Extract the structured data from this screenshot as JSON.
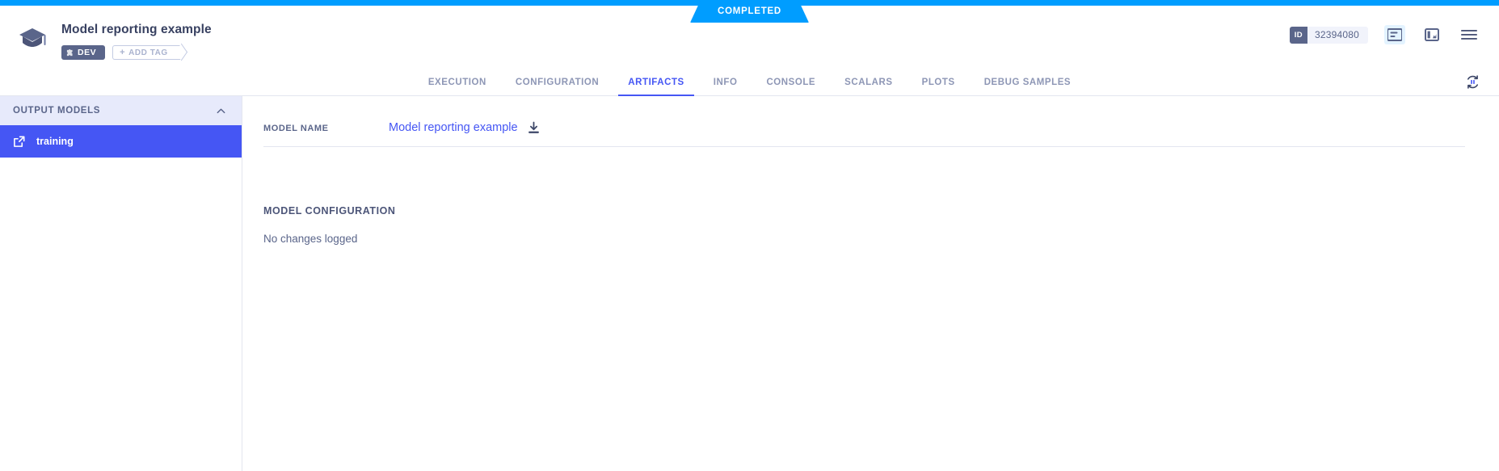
{
  "status": {
    "label": "COMPLETED",
    "bar_color": "#009dff"
  },
  "header": {
    "logo_icon": "graduation-cap-icon",
    "title": "Model reporting example",
    "tags": [
      {
        "icon": "puzzle-piece-icon",
        "label": "DEV"
      }
    ],
    "add_tag": {
      "plus": "+",
      "label": "ADD TAG"
    },
    "id_badge": {
      "tag": "ID",
      "value": "32394080"
    },
    "icons": [
      {
        "name": "details-panel-icon",
        "active": true
      },
      {
        "name": "split-view-icon",
        "active": false
      },
      {
        "name": "menu-icon",
        "active": false
      }
    ]
  },
  "tabs": [
    {
      "label": "EXECUTION",
      "active": false
    },
    {
      "label": "CONFIGURATION",
      "active": false
    },
    {
      "label": "ARTIFACTS",
      "active": true
    },
    {
      "label": "INFO",
      "active": false
    },
    {
      "label": "CONSOLE",
      "active": false
    },
    {
      "label": "SCALARS",
      "active": false
    },
    {
      "label": "PLOTS",
      "active": false
    },
    {
      "label": "DEBUG SAMPLES",
      "active": false
    }
  ],
  "tabbar_right": {
    "refresh_icon": "refresh-paused-icon"
  },
  "sidebar": {
    "section_title": "OUTPUT MODELS",
    "collapse_icon": "chevron-up-icon",
    "items": [
      {
        "label": "training",
        "icon": "external-link-icon",
        "selected": true
      }
    ]
  },
  "main": {
    "model_name_label": "MODEL NAME",
    "model_name_value": "Model reporting example",
    "download_icon": "download-icon",
    "configuration_title": "MODEL CONFIGURATION",
    "configuration_body": "No changes logged"
  },
  "colors": {
    "accent_blue": "#4556f4",
    "status_blue": "#009dff",
    "text_slate": "#5a658a",
    "sidebar_header_bg": "#e7eafb"
  }
}
